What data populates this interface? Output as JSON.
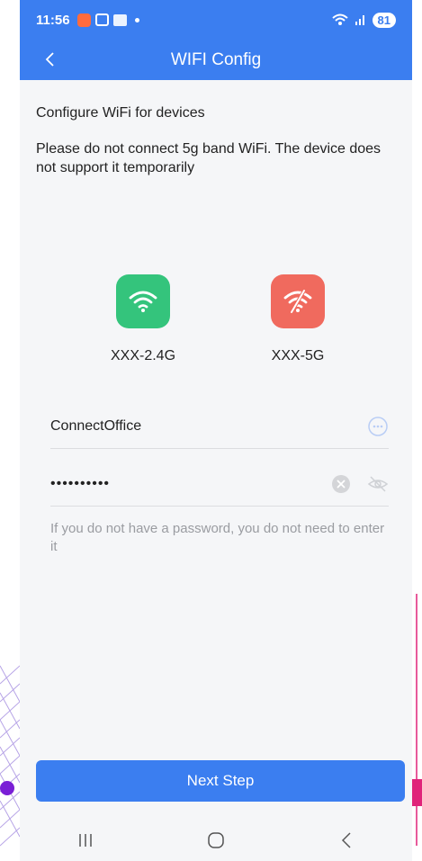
{
  "status_bar": {
    "time": "11:56",
    "battery": "81"
  },
  "app_bar": {
    "title": "WIFI Config"
  },
  "content": {
    "section_title": "Configure WiFi for devices",
    "notice": "Please do not connect 5g band WiFi. The device does not support it temporarily",
    "wifi_options": [
      {
        "label": "XXX-2.4G",
        "icon": "wifi-icon",
        "color": "#34c47c"
      },
      {
        "label": "XXX-5G",
        "icon": "wifi-off-icon",
        "color": "#f06a5e"
      }
    ],
    "ssid_field": {
      "value": "ConnectOffice"
    },
    "password_field": {
      "value": "••••••••••"
    },
    "hint": "If you do not have a password, you do not need to enter it"
  },
  "next_button": {
    "label": "Next Step"
  },
  "colors": {
    "primary": "#3b7ef0",
    "background": "#f5f6f8"
  }
}
